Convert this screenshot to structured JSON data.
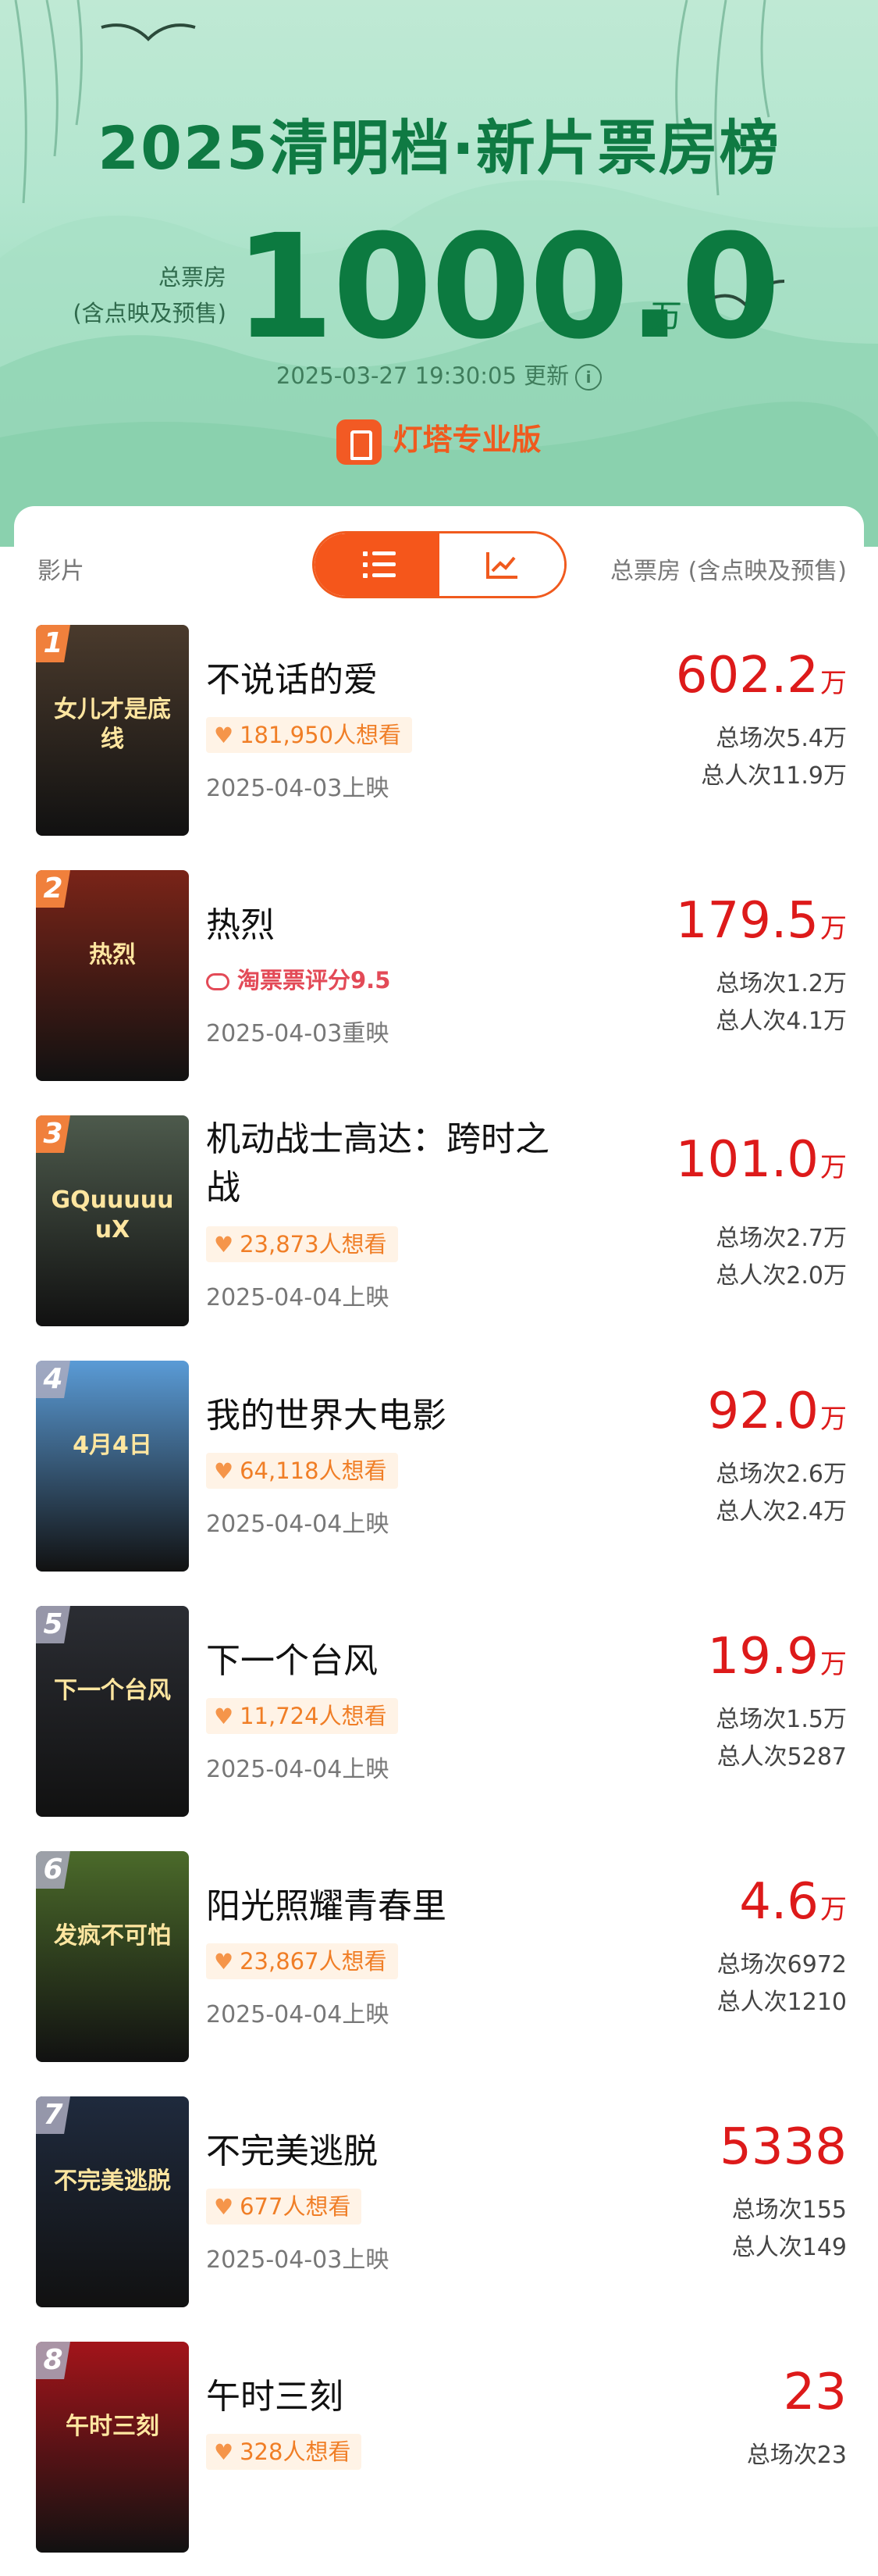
{
  "header": {
    "title": "2025清明档·新片票房榜",
    "total_label_line1": "总票房",
    "total_label_line2": "(含点映及预售)",
    "total_value": "1000.0",
    "total_unit": "万",
    "update_text": "2025-03-27 19:30:05 更新",
    "brand_name": "灯塔专业版"
  },
  "list_header": {
    "left_label": "影片",
    "right_label": "总票房 (含点映及预售)",
    "view_toggle_selected": "list"
  },
  "movies": [
    {
      "rank": "1",
      "title": "不说话的爱",
      "tag": "181,950人想看",
      "tag_type": "want",
      "date": "2025-04-03上映",
      "box": "602.2",
      "unit": "万",
      "shows": "总场次5.4万",
      "viewers": "总人次11.9万",
      "poster_color": "#4a3a2c",
      "poster_text": "女儿才是底线"
    },
    {
      "rank": "2",
      "title": "热烈",
      "tag": "淘票票评分9.5",
      "tag_type": "rating",
      "date": "2025-04-03重映",
      "box": "179.5",
      "unit": "万",
      "shows": "总场次1.2万",
      "viewers": "总人次4.1万",
      "poster_color": "#7a2418",
      "poster_text": "热烈"
    },
    {
      "rank": "3",
      "title": "机动战士高达：跨时之战",
      "tag": "23,873人想看",
      "tag_type": "want",
      "date": "2025-04-04上映",
      "box": "101.0",
      "unit": "万",
      "shows": "总场次2.7万",
      "viewers": "总人次2.0万",
      "poster_color": "#4d5a4c",
      "poster_text": "GQuuuuuuX"
    },
    {
      "rank": "4",
      "title": "我的世界大电影",
      "tag": "64,118人想看",
      "tag_type": "want",
      "date": "2025-04-04上映",
      "box": "92.0",
      "unit": "万",
      "shows": "总场次2.6万",
      "viewers": "总人次2.4万",
      "poster_color": "#5a9bd6",
      "poster_text": "4月4日"
    },
    {
      "rank": "5",
      "title": "下一个台风",
      "tag": "11,724人想看",
      "tag_type": "want",
      "date": "2025-04-04上映",
      "box": "19.9",
      "unit": "万",
      "shows": "总场次1.5万",
      "viewers": "总人次5287",
      "poster_color": "#2b2d33",
      "poster_text": "下一个台风"
    },
    {
      "rank": "6",
      "title": "阳光照耀青春里",
      "tag": "23,867人想看",
      "tag_type": "want",
      "date": "2025-04-04上映",
      "box": "4.6",
      "unit": "万",
      "shows": "总场次6972",
      "viewers": "总人次1210",
      "poster_color": "#4b6a2a",
      "poster_text": "发疯不可怕"
    },
    {
      "rank": "7",
      "title": "不完美逃脱",
      "tag": "677人想看",
      "tag_type": "want",
      "date": "2025-04-03上映",
      "box": "5338",
      "unit": "",
      "shows": "总场次155",
      "viewers": "总人次149",
      "poster_color": "#1f2a3d",
      "poster_text": "不完美逃脱"
    },
    {
      "rank": "8",
      "title": "午时三刻",
      "tag": "328人想看",
      "tag_type": "want",
      "date": "",
      "box": "23",
      "unit": "",
      "shows": "总场次23",
      "viewers": "",
      "poster_color": "#a3141a",
      "poster_text": "午时三刻"
    }
  ],
  "colors": {
    "accent": "#f5561b",
    "box_red": "#dd1a1a",
    "title_green": "#0f7a43"
  }
}
